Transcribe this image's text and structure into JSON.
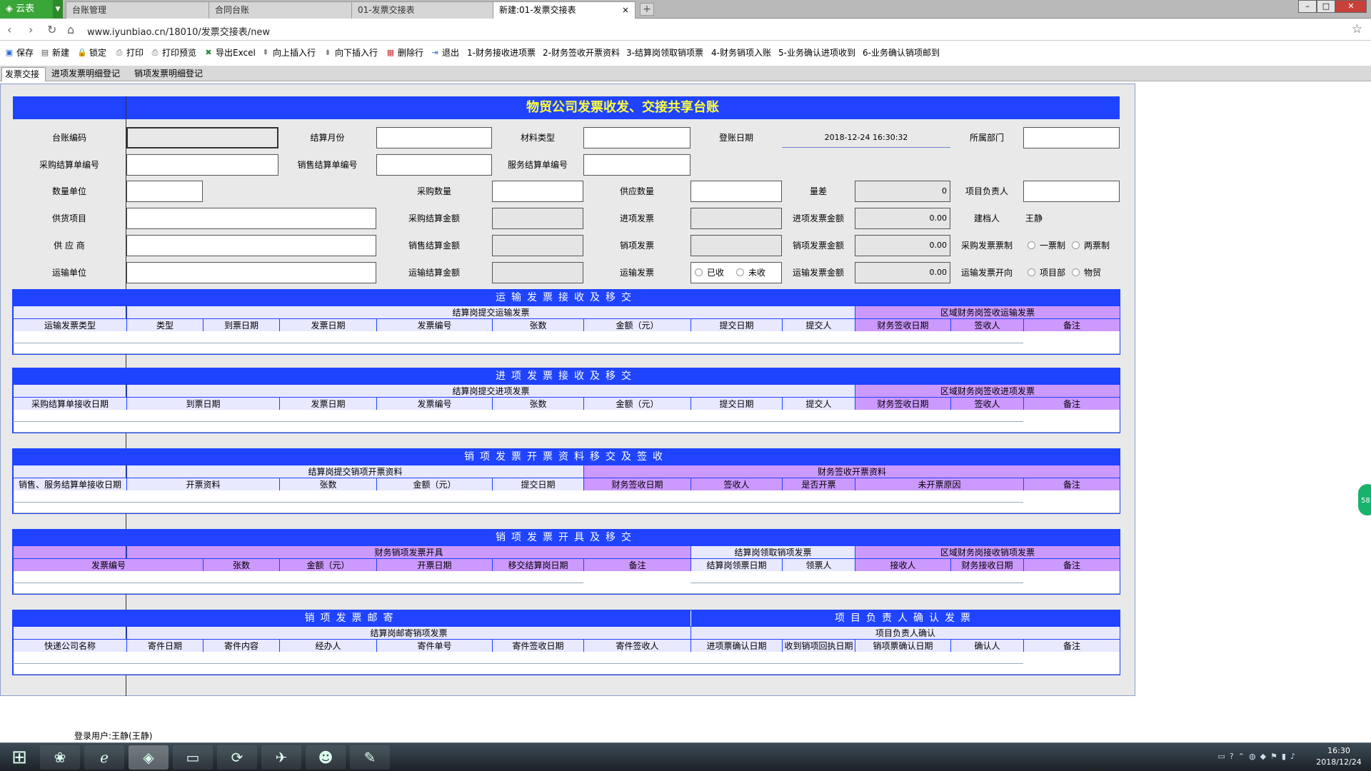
{
  "browser": {
    "app_label": "云表",
    "tabs": [
      "台账管理",
      "合同台账",
      "01-发票交接表",
      "新建:01-发票交接表"
    ],
    "close_glyph": "×",
    "newtab_glyph": "+",
    "url": "www.iyunbiao.cn/18010/发票交接表/new"
  },
  "toolbar": {
    "save": "保存",
    "new": "新建",
    "lock": "锁定",
    "print": "打印",
    "preview": "打印预览",
    "export": "导出Excel",
    "insert_above": "向上插入行",
    "insert_below": "向下插入行",
    "delete_row": "删除行",
    "exit": "退出",
    "steps": [
      "1-财务接收进项票",
      "2-财务签收开票资料",
      "3-结算岗领取销项票",
      "4-财务销项入账",
      "5-业务确认进项收到",
      "6-业务确认销项邮到"
    ]
  },
  "sheet_tabs": [
    "发票交接",
    "进项发票明细登记",
    "销项发票明细登记"
  ],
  "form": {
    "title": "物贸公司发票收发、交接共享台账",
    "labels": {
      "ledger_code": "台账编码",
      "settle_month": "结算月份",
      "material_type": "材料类型",
      "billing_date": "登账日期",
      "department": "所属部门",
      "purchase_settle_no": "采购结算单编号",
      "sales_settle_no": "销售结算单编号",
      "service_settle_no": "服务结算单编号",
      "qty_unit": "数量单位",
      "purchase_qty": "采购数量",
      "supply_qty": "供应数量",
      "qty_diff": "量差",
      "project_lead": "项目负责人",
      "supply_item": "供货项目",
      "purchase_amount": "采购结算金额",
      "input_invoice": "进项发票",
      "input_invoice_amount": "进项发票金额",
      "creator": "建档人",
      "supplier": "供 应 商",
      "sales_amount": "销售结算金额",
      "output_invoice": "销项发票",
      "output_invoice_amount": "销项发票金额",
      "purchase_invoice_system": "采购发票票制",
      "transport_unit": "运输单位",
      "transport_amount": "运输结算金额",
      "transport_invoice": "运输发票",
      "transport_invoice_amount": "运输发票金额",
      "transport_invoice_direction": "运输发票开向"
    },
    "values": {
      "billing_date": "2018-12-24 16:30:32",
      "qty_diff": "0",
      "input_invoice_amount": "0.00",
      "output_invoice_amount": "0.00",
      "transport_invoice_amount": "0.00",
      "creator": "王静"
    },
    "radios": {
      "invoice_system": [
        "一票制",
        "两票制"
      ],
      "transport_received": [
        "已收",
        "未收"
      ],
      "transport_direction": [
        "项目部",
        "物贸"
      ]
    }
  },
  "sections": {
    "transport": {
      "title": "运输发票接收及移交",
      "group_left": "结算岗提交运输发票",
      "group_right": "区域财务岗签收运输发票",
      "columns": [
        "运输发票类型",
        "类型",
        "到票日期",
        "发票日期",
        "发票编号",
        "张数",
        "金额（元）",
        "提交日期",
        "提交人",
        "财务签收日期",
        "签收人",
        "备注"
      ]
    },
    "input": {
      "title": "进项发票接收及移交",
      "group_left": "结算岗提交进项发票",
      "group_right": "区域财务岗签收进项发票",
      "columns": [
        "采购结算单接收日期",
        "到票日期",
        "发票日期",
        "发票编号",
        "张数",
        "金额（元）",
        "提交日期",
        "提交人",
        "财务签收日期",
        "签收人",
        "备注"
      ]
    },
    "output_data": {
      "title": "销项发票开票资料移交及签收",
      "group_left": "结算岗提交销项开票资料",
      "group_right": "财务签收开票资料",
      "columns": [
        "销售、服务结算单接收日期",
        "开票资料",
        "张数",
        "金额（元）",
        "提交日期",
        "财务签收日期",
        "签收人",
        "是否开票",
        "未开票原因",
        "备注"
      ]
    },
    "output_issue": {
      "title": "销项发票开具及移交",
      "group_left": "财务销项发票开具",
      "group_mid": "结算岗领取销项发票",
      "group_right": "区域财务岗接收销项发票",
      "columns": [
        "发票编号",
        "张数",
        "金额（元）",
        "开票日期",
        "移交结算岗日期",
        "备注",
        "结算岗领票日期",
        "领票人",
        "接收人",
        "财务接收日期",
        "备注"
      ]
    },
    "mailing": {
      "title": "销项发票邮寄",
      "title_right": "项目负责人确认发票",
      "group_left": "结算岗邮寄销项发票",
      "group_right": "项目负责人确认",
      "columns": [
        "快递公司名称",
        "寄件日期",
        "寄件内容",
        "经办人",
        "寄件单号",
        "寄件签收日期",
        "寄件签收人",
        "进项票确认日期",
        "收到销项回执日期",
        "销项票确认日期",
        "确认人",
        "备注"
      ]
    }
  },
  "float_badge": "58",
  "status": "登录用户:王静(王静)",
  "clock": {
    "time": "16:30",
    "date": "2018/12/24"
  }
}
